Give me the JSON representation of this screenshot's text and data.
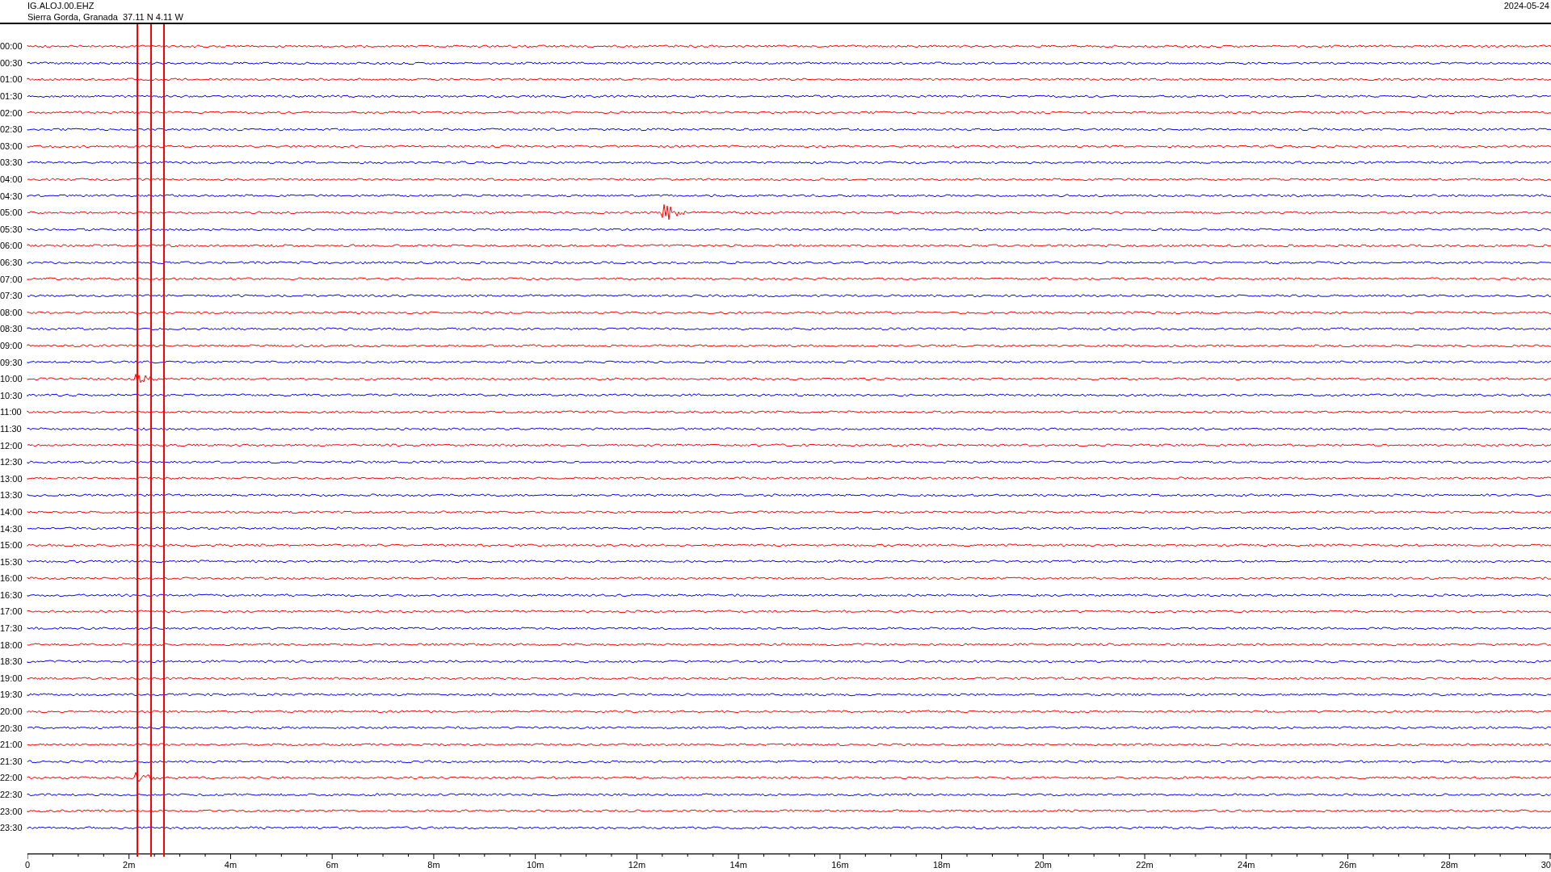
{
  "header": {
    "channel": "IG.ALOJ.00.EHZ",
    "location": "Sierra Gorda, Granada  37.11 N 4.11 W",
    "date": "2024-05-24"
  },
  "traces": [
    {
      "label": "00:00",
      "color": "#ff0000"
    },
    {
      "label": "00:30",
      "color": "#0000ff"
    },
    {
      "label": "01:00",
      "color": "#ff0000"
    },
    {
      "label": "01:30",
      "color": "#0000ff"
    },
    {
      "label": "02:00",
      "color": "#ff0000"
    },
    {
      "label": "02:30",
      "color": "#0000ff"
    },
    {
      "label": "03:00",
      "color": "#ff0000"
    },
    {
      "label": "03:30",
      "color": "#0000ff"
    },
    {
      "label": "04:00",
      "color": "#ff0000"
    },
    {
      "label": "04:30",
      "color": "#0000ff"
    },
    {
      "label": "05:00",
      "color": "#ff0000"
    },
    {
      "label": "05:30",
      "color": "#0000ff"
    },
    {
      "label": "06:00",
      "color": "#ff0000"
    },
    {
      "label": "06:30",
      "color": "#0000ff"
    },
    {
      "label": "07:00",
      "color": "#ff0000"
    },
    {
      "label": "07:30",
      "color": "#0000ff"
    },
    {
      "label": "08:00",
      "color": "#ff0000"
    },
    {
      "label": "08:30",
      "color": "#0000ff"
    },
    {
      "label": "09:00",
      "color": "#ff0000"
    },
    {
      "label": "09:30",
      "color": "#0000ff"
    },
    {
      "label": "10:00",
      "color": "#ff0000"
    },
    {
      "label": "10:30",
      "color": "#0000ff"
    },
    {
      "label": "11:00",
      "color": "#ff0000"
    },
    {
      "label": "11:30",
      "color": "#0000ff"
    },
    {
      "label": "12:00",
      "color": "#ff0000"
    },
    {
      "label": "12:30",
      "color": "#0000ff"
    },
    {
      "label": "13:00",
      "color": "#ff0000"
    },
    {
      "label": "13:30",
      "color": "#0000ff"
    },
    {
      "label": "14:00",
      "color": "#ff0000"
    },
    {
      "label": "14:30",
      "color": "#0000ff"
    },
    {
      "label": "15:00",
      "color": "#ff0000"
    },
    {
      "label": "15:30",
      "color": "#0000ff"
    },
    {
      "label": "16:00",
      "color": "#ff0000"
    },
    {
      "label": "16:30",
      "color": "#0000ff"
    },
    {
      "label": "17:00",
      "color": "#ff0000"
    },
    {
      "label": "17:30",
      "color": "#0000ff"
    },
    {
      "label": "18:00",
      "color": "#ff0000"
    },
    {
      "label": "18:30",
      "color": "#0000ff"
    },
    {
      "label": "19:00",
      "color": "#ff0000"
    },
    {
      "label": "19:30",
      "color": "#0000ff"
    },
    {
      "label": "20:00",
      "color": "#ff0000"
    },
    {
      "label": "20:30",
      "color": "#0000ff"
    },
    {
      "label": "21:00",
      "color": "#ff0000"
    },
    {
      "label": "21:30",
      "color": "#0000ff"
    },
    {
      "label": "22:00",
      "color": "#ff0000"
    },
    {
      "label": "22:30",
      "color": "#0000ff"
    },
    {
      "label": "23:00",
      "color": "#ff0000"
    },
    {
      "label": "23:30",
      "color": "#0000ff"
    }
  ],
  "axis": {
    "ticks": [
      "0",
      "2m",
      "4m",
      "6m",
      "8m",
      "10m",
      "12m",
      "14m",
      "16m",
      "18m",
      "20m",
      "22m",
      "24m",
      "26m",
      "28m",
      "30"
    ]
  }
}
